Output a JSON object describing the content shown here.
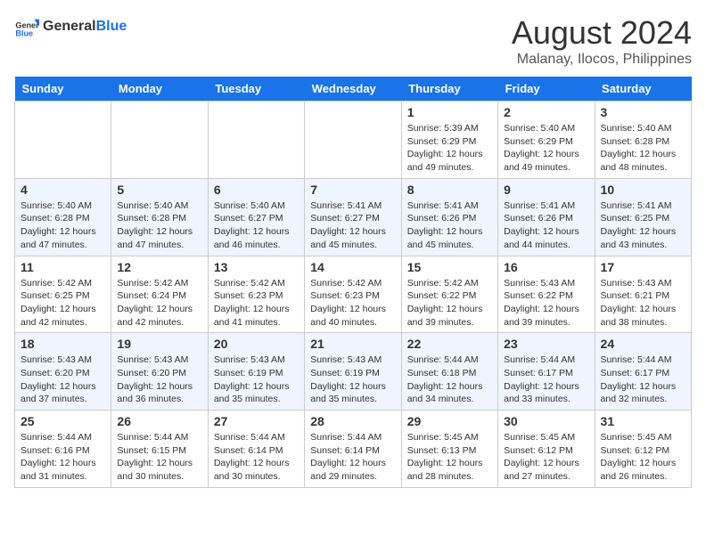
{
  "header": {
    "logo_general": "General",
    "logo_blue": "Blue",
    "month_year": "August 2024",
    "location": "Malanay, Ilocos, Philippines"
  },
  "weekdays": [
    "Sunday",
    "Monday",
    "Tuesday",
    "Wednesday",
    "Thursday",
    "Friday",
    "Saturday"
  ],
  "weeks": [
    [
      {
        "day": "",
        "data": ""
      },
      {
        "day": "",
        "data": ""
      },
      {
        "day": "",
        "data": ""
      },
      {
        "day": "",
        "data": ""
      },
      {
        "day": "1",
        "data": "Sunrise: 5:39 AM\nSunset: 6:29 PM\nDaylight: 12 hours and 49 minutes."
      },
      {
        "day": "2",
        "data": "Sunrise: 5:40 AM\nSunset: 6:29 PM\nDaylight: 12 hours and 49 minutes."
      },
      {
        "day": "3",
        "data": "Sunrise: 5:40 AM\nSunset: 6:28 PM\nDaylight: 12 hours and 48 minutes."
      }
    ],
    [
      {
        "day": "4",
        "data": "Sunrise: 5:40 AM\nSunset: 6:28 PM\nDaylight: 12 hours and 47 minutes."
      },
      {
        "day": "5",
        "data": "Sunrise: 5:40 AM\nSunset: 6:28 PM\nDaylight: 12 hours and 47 minutes."
      },
      {
        "day": "6",
        "data": "Sunrise: 5:40 AM\nSunset: 6:27 PM\nDaylight: 12 hours and 46 minutes."
      },
      {
        "day": "7",
        "data": "Sunrise: 5:41 AM\nSunset: 6:27 PM\nDaylight: 12 hours and 45 minutes."
      },
      {
        "day": "8",
        "data": "Sunrise: 5:41 AM\nSunset: 6:26 PM\nDaylight: 12 hours and 45 minutes."
      },
      {
        "day": "9",
        "data": "Sunrise: 5:41 AM\nSunset: 6:26 PM\nDaylight: 12 hours and 44 minutes."
      },
      {
        "day": "10",
        "data": "Sunrise: 5:41 AM\nSunset: 6:25 PM\nDaylight: 12 hours and 43 minutes."
      }
    ],
    [
      {
        "day": "11",
        "data": "Sunrise: 5:42 AM\nSunset: 6:25 PM\nDaylight: 12 hours and 42 minutes."
      },
      {
        "day": "12",
        "data": "Sunrise: 5:42 AM\nSunset: 6:24 PM\nDaylight: 12 hours and 42 minutes."
      },
      {
        "day": "13",
        "data": "Sunrise: 5:42 AM\nSunset: 6:23 PM\nDaylight: 12 hours and 41 minutes."
      },
      {
        "day": "14",
        "data": "Sunrise: 5:42 AM\nSunset: 6:23 PM\nDaylight: 12 hours and 40 minutes."
      },
      {
        "day": "15",
        "data": "Sunrise: 5:42 AM\nSunset: 6:22 PM\nDaylight: 12 hours and 39 minutes."
      },
      {
        "day": "16",
        "data": "Sunrise: 5:43 AM\nSunset: 6:22 PM\nDaylight: 12 hours and 39 minutes."
      },
      {
        "day": "17",
        "data": "Sunrise: 5:43 AM\nSunset: 6:21 PM\nDaylight: 12 hours and 38 minutes."
      }
    ],
    [
      {
        "day": "18",
        "data": "Sunrise: 5:43 AM\nSunset: 6:20 PM\nDaylight: 12 hours and 37 minutes."
      },
      {
        "day": "19",
        "data": "Sunrise: 5:43 AM\nSunset: 6:20 PM\nDaylight: 12 hours and 36 minutes."
      },
      {
        "day": "20",
        "data": "Sunrise: 5:43 AM\nSunset: 6:19 PM\nDaylight: 12 hours and 35 minutes."
      },
      {
        "day": "21",
        "data": "Sunrise: 5:43 AM\nSunset: 6:19 PM\nDaylight: 12 hours and 35 minutes."
      },
      {
        "day": "22",
        "data": "Sunrise: 5:44 AM\nSunset: 6:18 PM\nDaylight: 12 hours and 34 minutes."
      },
      {
        "day": "23",
        "data": "Sunrise: 5:44 AM\nSunset: 6:17 PM\nDaylight: 12 hours and 33 minutes."
      },
      {
        "day": "24",
        "data": "Sunrise: 5:44 AM\nSunset: 6:17 PM\nDaylight: 12 hours and 32 minutes."
      }
    ],
    [
      {
        "day": "25",
        "data": "Sunrise: 5:44 AM\nSunset: 6:16 PM\nDaylight: 12 hours and 31 minutes."
      },
      {
        "day": "26",
        "data": "Sunrise: 5:44 AM\nSunset: 6:15 PM\nDaylight: 12 hours and 30 minutes."
      },
      {
        "day": "27",
        "data": "Sunrise: 5:44 AM\nSunset: 6:14 PM\nDaylight: 12 hours and 30 minutes."
      },
      {
        "day": "28",
        "data": "Sunrise: 5:44 AM\nSunset: 6:14 PM\nDaylight: 12 hours and 29 minutes."
      },
      {
        "day": "29",
        "data": "Sunrise: 5:45 AM\nSunset: 6:13 PM\nDaylight: 12 hours and 28 minutes."
      },
      {
        "day": "30",
        "data": "Sunrise: 5:45 AM\nSunset: 6:12 PM\nDaylight: 12 hours and 27 minutes."
      },
      {
        "day": "31",
        "data": "Sunrise: 5:45 AM\nSunset: 6:12 PM\nDaylight: 12 hours and 26 minutes."
      }
    ]
  ]
}
